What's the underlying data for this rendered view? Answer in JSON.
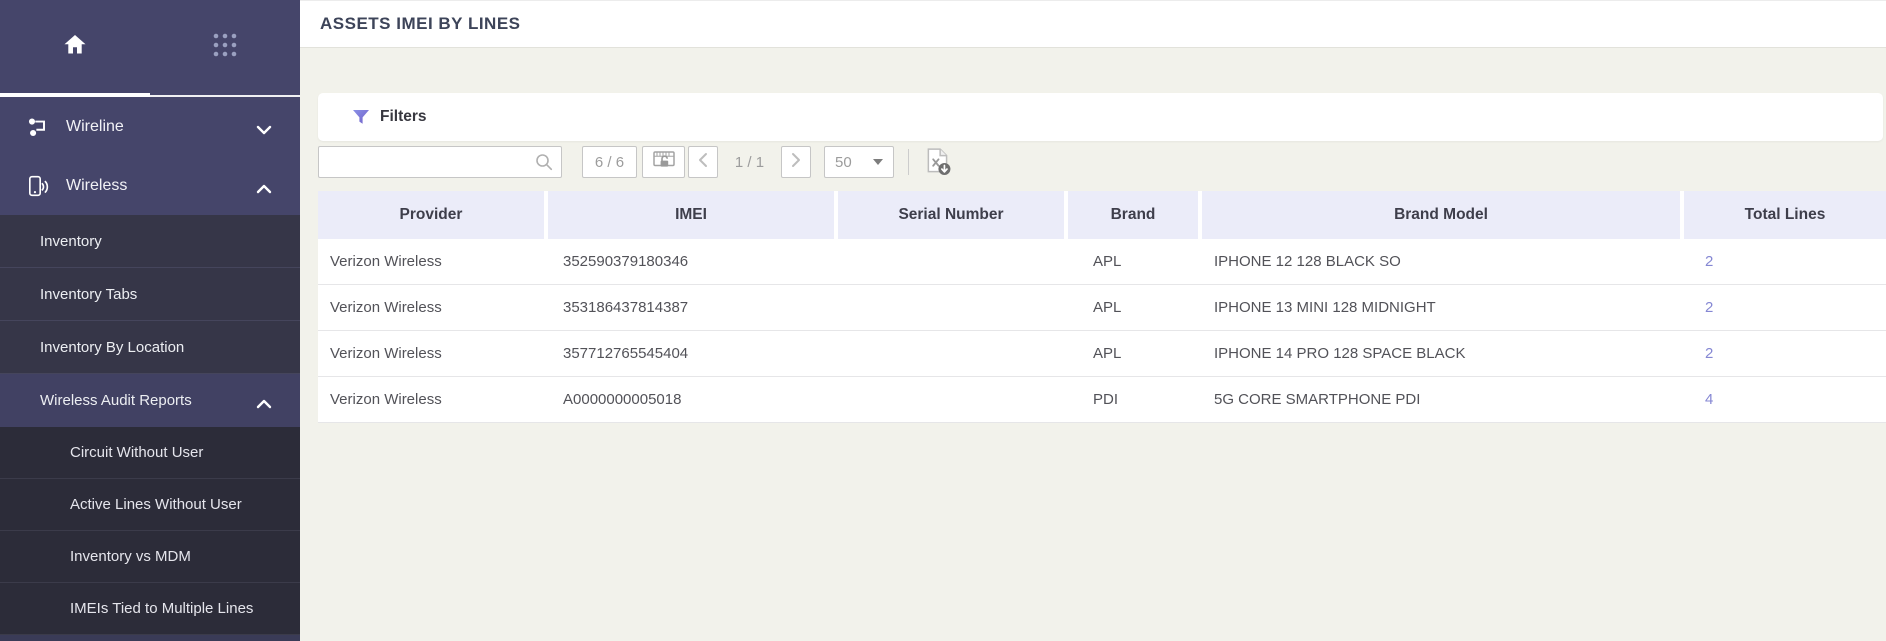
{
  "page": {
    "title": "ASSETS IMEI BY LINES"
  },
  "colors": {
    "sidebar_bg": "#45456a",
    "sidebar_submenu_bg": "#363648",
    "sidebar_deep_submenu_bg": "#2c2c39",
    "content_bg": "#f2f2eb",
    "table_header_bg": "#ebecf9",
    "accent_filter": "#7b80d6",
    "total_lines_link": "#8587d3"
  },
  "icons": {
    "home": "house-glyph",
    "apps_grid": "3x3-dots",
    "wireline": "network-nodes",
    "wireless": "smartphone-with-waves",
    "chevron_down": "v",
    "chevron_up": "^",
    "filter": "funnel",
    "search": "magnifier",
    "lock_columns": "panel-with-padlock",
    "prev_page": "‹",
    "next_page": "›",
    "dropdown_caret": "▾",
    "export_excel": "file-x-with-download-badge"
  },
  "sidebar": {
    "items": [
      {
        "label": "Wireline",
        "level": 1,
        "state": "collapsed"
      },
      {
        "label": "Wireless",
        "level": 1,
        "state": "expanded"
      },
      {
        "label": "Inventory",
        "level": 2
      },
      {
        "label": "Inventory Tabs",
        "level": 2
      },
      {
        "label": "Inventory By Location",
        "level": 2
      },
      {
        "label": "Wireless Audit Reports",
        "level": 2,
        "state": "expanded"
      },
      {
        "label": "Circuit Without User",
        "level": 3
      },
      {
        "label": "Active Lines Without User",
        "level": 3
      },
      {
        "label": "Inventory vs MDM",
        "level": 3
      },
      {
        "label": "IMEIs Tied to Multiple Lines",
        "level": 3
      }
    ]
  },
  "filters": {
    "label": "Filters"
  },
  "toolbar": {
    "search_value": "",
    "search_placeholder": "",
    "records_count": "6 / 6",
    "page_indicator": "1 / 1",
    "page_size": "50"
  },
  "table": {
    "columns": [
      "Provider",
      "IMEI",
      "Serial Number",
      "Brand",
      "Brand Model",
      "Total Lines"
    ],
    "rows": [
      [
        "Verizon Wireless",
        "352590379180346",
        "",
        "APL",
        "IPHONE 12 128 BLACK SO",
        "2"
      ],
      [
        "Verizon Wireless",
        "353186437814387",
        "",
        "APL",
        "IPHONE 13 MINI 128 MIDNIGHT",
        "2"
      ],
      [
        "Verizon Wireless",
        "357712765545404",
        "",
        "APL",
        "IPHONE 14 PRO 128 SPACE BLACK",
        "2"
      ],
      [
        "Verizon Wireless",
        "A0000000005018",
        "",
        "PDI",
        "5G CORE SMARTPHONE PDI",
        "4"
      ]
    ]
  }
}
